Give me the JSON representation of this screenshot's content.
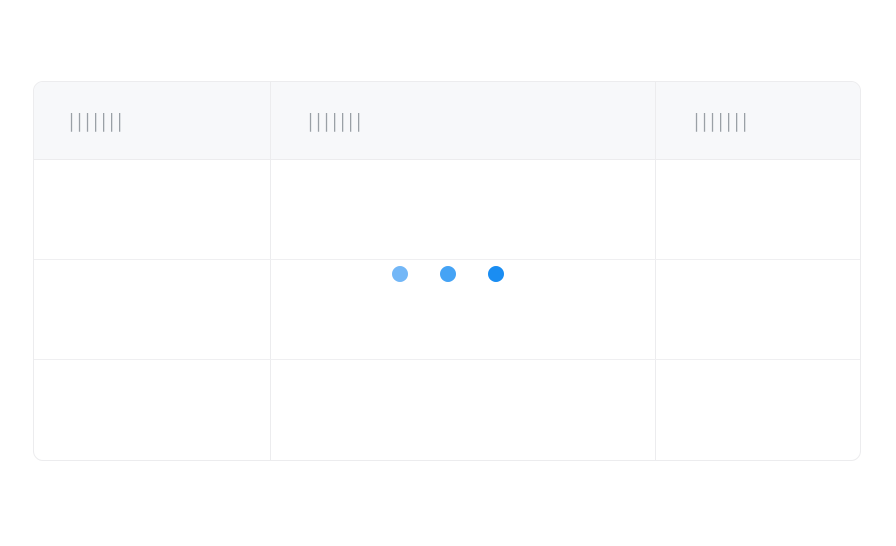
{
  "table": {
    "columns": [
      {
        "label": "|||||||"
      },
      {
        "label": "||||||| "
      },
      {
        "label": "|||||||"
      }
    ],
    "rows": [
      [
        "",
        "",
        ""
      ],
      [
        "",
        "",
        ""
      ],
      [
        "",
        "",
        ""
      ]
    ]
  },
  "loader": {
    "dot_colors": [
      "#73b7f7",
      "#45a3f5",
      "#1a8df2"
    ]
  },
  "colors": {
    "header_bg": "#f7f8fa",
    "border": "#ececee",
    "header_text": "#9aa0a6"
  }
}
